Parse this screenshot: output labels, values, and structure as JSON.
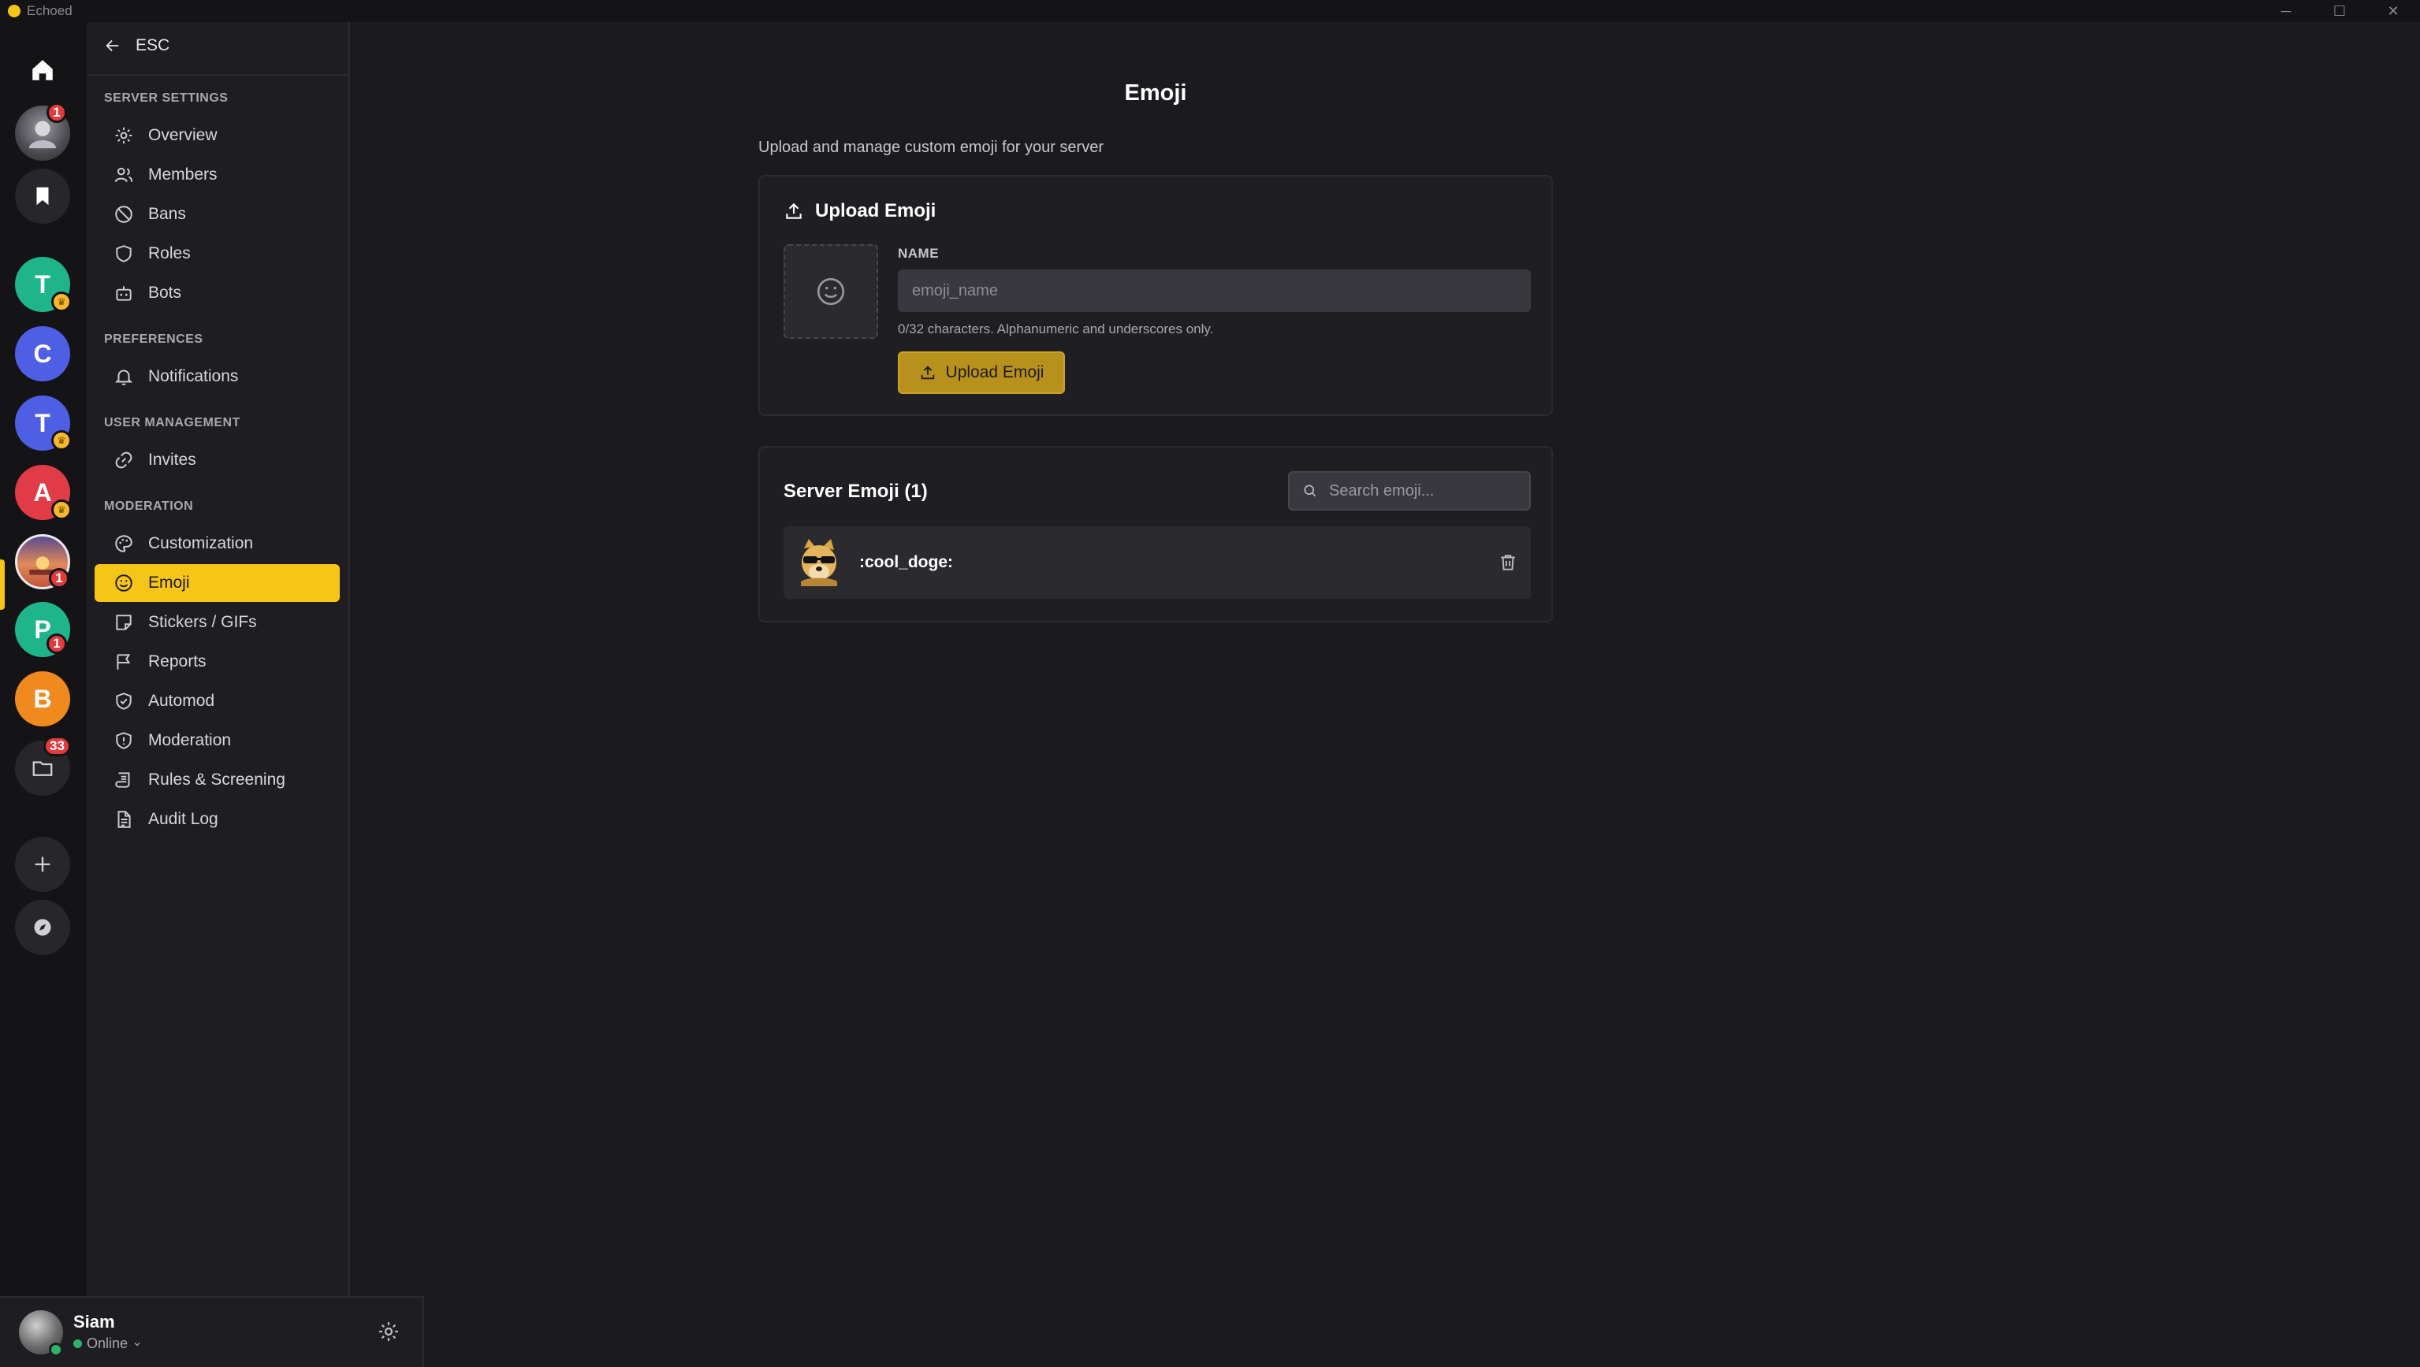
{
  "app": {
    "title": "Echoed"
  },
  "window_controls": {
    "minimize": "─",
    "maximize": "☐",
    "close": "✕"
  },
  "server_rail": {
    "items": [
      {
        "letter": "T",
        "color": "#1fb58a",
        "crown": true
      },
      {
        "letter": "C",
        "color": "#4e5fe6",
        "crown": false
      },
      {
        "letter": "T",
        "color": "#4e5fe6",
        "crown": true
      },
      {
        "letter": "A",
        "color": "#e23b48",
        "crown": true
      },
      {
        "letter": "P",
        "color": "#1fb58a",
        "badge": "1"
      },
      {
        "letter": "B",
        "color": "#f08a1f",
        "crown": false
      }
    ],
    "badges": {
      "avatar_server": "1",
      "image_server": "1",
      "p_server": "1",
      "folder": "33"
    }
  },
  "sidebar": {
    "back_label": "ESC",
    "sections": [
      {
        "heading": "SERVER SETTINGS",
        "items": [
          "Overview",
          "Members",
          "Bans",
          "Roles",
          "Bots"
        ]
      },
      {
        "heading": "PREFERENCES",
        "items": [
          "Notifications"
        ]
      },
      {
        "heading": "USER MANAGEMENT",
        "items": [
          "Invites"
        ]
      },
      {
        "heading": "MODERATION",
        "items": [
          "Customization",
          "Emoji",
          "Stickers / GIFs",
          "Reports",
          "Automod",
          "Moderation",
          "Rules & Screening",
          "Audit Log"
        ]
      }
    ],
    "active_item": "Emoji"
  },
  "user": {
    "name": "Siam",
    "status": "Online"
  },
  "page": {
    "title": "Emoji",
    "subtitle": "Upload and manage custom emoji for your server"
  },
  "upload_card": {
    "heading": "Upload Emoji",
    "name_label": "NAME",
    "name_placeholder": "emoji_name",
    "hint": "0/32 characters. Alphanumeric and underscores only.",
    "button_label": "Upload Emoji"
  },
  "emoji_list": {
    "heading": "Server Emoji (1)",
    "search_placeholder": "Search emoji...",
    "items": [
      {
        "name": ":cool_doge:"
      }
    ]
  },
  "colors": {
    "accent": "#f5c518",
    "upload_button": "#b8901c",
    "online": "#2fb36b",
    "badge": "#e23b3b"
  }
}
